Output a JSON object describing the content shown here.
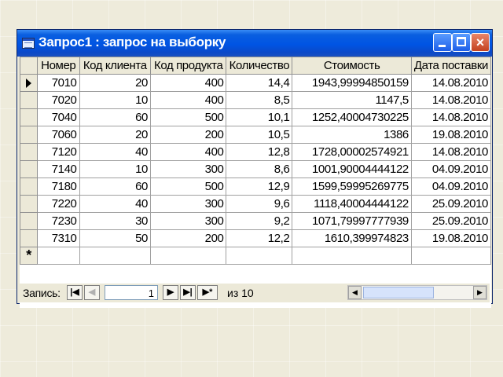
{
  "window": {
    "title": "Запрос1 : запрос на выборку",
    "minimize_glyph": "",
    "maximize_glyph": "",
    "close_glyph": "×"
  },
  "columns": [
    "Номер",
    "Код клиента",
    "Код продукта",
    "Количество",
    "Стоимость",
    "Дата поставки"
  ],
  "rows": [
    [
      "7010",
      "20",
      "400",
      "14,4",
      "1943,99994850159",
      "14.08.2010"
    ],
    [
      "7020",
      "10",
      "400",
      "8,5",
      "1147,5",
      "14.08.2010"
    ],
    [
      "7040",
      "60",
      "500",
      "10,1",
      "1252,40004730225",
      "14.08.2010"
    ],
    [
      "7060",
      "20",
      "200",
      "10,5",
      "1386",
      "19.08.2010"
    ],
    [
      "7120",
      "40",
      "400",
      "12,8",
      "1728,00002574921",
      "14.08.2010"
    ],
    [
      "7140",
      "10",
      "300",
      "8,6",
      "1001,90004444122",
      "04.09.2010"
    ],
    [
      "7180",
      "60",
      "500",
      "12,9",
      "1599,59995269775",
      "04.09.2010"
    ],
    [
      "7220",
      "40",
      "300",
      "9,6",
      "1118,40004444122",
      "25.09.2010"
    ],
    [
      "7230",
      "30",
      "300",
      "9,2",
      "1071,79997777939",
      "25.09.2010"
    ],
    [
      "7310",
      "50",
      "200",
      "12,2",
      "1610,399974823",
      "19.08.2010"
    ]
  ],
  "new_row_marker": "*",
  "navigator": {
    "label": "Запись:",
    "current_record": "1",
    "of_text": "из  10",
    "first_glyph": "|◀",
    "prev_glyph": "◀",
    "next_glyph": "▶",
    "last_glyph": "▶|",
    "new_glyph": "▶*",
    "scroll_left_glyph": "◀",
    "scroll_right_glyph": "▶"
  }
}
